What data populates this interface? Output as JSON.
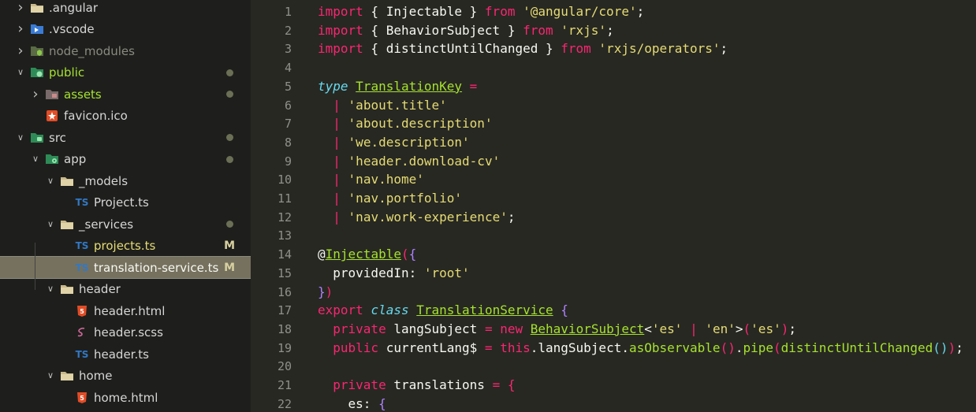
{
  "explorer": {
    "items": [
      {
        "label": ".angular",
        "icon": "folder-icon",
        "depth": 0,
        "chevron": "right",
        "color": "#d6d6d6"
      },
      {
        "label": ".vscode",
        "icon": "vscode-folder-icon",
        "depth": 0,
        "chevron": "right",
        "color": "#d6d6d6"
      },
      {
        "label": "node_modules",
        "icon": "node-folder-icon",
        "depth": 0,
        "chevron": "right",
        "color": "#8a8a80"
      },
      {
        "label": "public",
        "icon": "public-folder-icon",
        "depth": 0,
        "chevron": "down",
        "color": "#a6e22e",
        "dot": true
      },
      {
        "label": "assets",
        "icon": "assets-folder-icon",
        "depth": 1,
        "chevron": "right",
        "color": "#a6e22e",
        "dot": true
      },
      {
        "label": "favicon.ico",
        "icon": "favicon-icon",
        "depth": 1,
        "chevron": "none",
        "color": "#d6d6d6"
      },
      {
        "label": "src",
        "icon": "src-folder-icon",
        "depth": 0,
        "chevron": "down",
        "color": "#d6d6d6",
        "dot": true
      },
      {
        "label": "app",
        "icon": "app-folder-icon",
        "depth": 1,
        "chevron": "down",
        "color": "#d6d6d6",
        "dot": true
      },
      {
        "label": "_models",
        "icon": "folder-icon",
        "depth": 2,
        "chevron": "down",
        "color": "#d6d6d6"
      },
      {
        "label": "Project.ts",
        "icon": "typescript-icon",
        "depth": 3,
        "chevron": "none",
        "color": "#d6d6d6"
      },
      {
        "label": "_services",
        "icon": "folder-icon",
        "depth": 2,
        "chevron": "down",
        "color": "#d6d6d6",
        "dot": true
      },
      {
        "label": "projects.ts",
        "icon": "typescript-icon",
        "depth": 3,
        "chevron": "none",
        "color": "#e6db74",
        "badge": "M"
      },
      {
        "label": "translation-service.ts",
        "icon": "typescript-icon",
        "depth": 3,
        "chevron": "none",
        "color": "#f8f8f2",
        "badge": "M",
        "selected": true
      },
      {
        "label": "header",
        "icon": "folder-icon",
        "depth": 2,
        "chevron": "down",
        "color": "#d6d6d6"
      },
      {
        "label": "header.html",
        "icon": "html-icon",
        "depth": 3,
        "chevron": "none",
        "color": "#d6d6d6"
      },
      {
        "label": "header.scss",
        "icon": "sass-icon",
        "depth": 3,
        "chevron": "none",
        "color": "#d6d6d6"
      },
      {
        "label": "header.ts",
        "icon": "typescript-icon",
        "depth": 3,
        "chevron": "none",
        "color": "#d6d6d6"
      },
      {
        "label": "home",
        "icon": "folder-icon",
        "depth": 2,
        "chevron": "down",
        "color": "#d6d6d6"
      },
      {
        "label": "home.html",
        "icon": "html-icon",
        "depth": 3,
        "chevron": "none",
        "color": "#d6d6d6"
      }
    ]
  },
  "editor": {
    "lines": [
      [
        [
          "k",
          "import"
        ],
        [
          "p",
          " { Injectable } "
        ],
        [
          "k",
          "from"
        ],
        [
          "p",
          " "
        ],
        [
          "s",
          "'@angular/core'"
        ],
        [
          "p",
          ";"
        ]
      ],
      [
        [
          "k",
          "import"
        ],
        [
          "p",
          " { BehaviorSubject } "
        ],
        [
          "k",
          "from"
        ],
        [
          "p",
          " "
        ],
        [
          "s",
          "'rxjs'"
        ],
        [
          "p",
          ";"
        ]
      ],
      [
        [
          "k",
          "import"
        ],
        [
          "p",
          " { distinctUntilChanged } "
        ],
        [
          "k",
          "from"
        ],
        [
          "p",
          " "
        ],
        [
          "s",
          "'rxjs/operators'"
        ],
        [
          "p",
          ";"
        ]
      ],
      [],
      [
        [
          "t",
          "type"
        ],
        [
          "p",
          " "
        ],
        [
          "c",
          "TranslationKey"
        ],
        [
          "p",
          " "
        ],
        [
          "k",
          "="
        ]
      ],
      [
        [
          "p",
          "  "
        ],
        [
          "k",
          "|"
        ],
        [
          "p",
          " "
        ],
        [
          "s",
          "'about.title'"
        ]
      ],
      [
        [
          "p",
          "  "
        ],
        [
          "k",
          "|"
        ],
        [
          "p",
          " "
        ],
        [
          "s",
          "'about.description'"
        ]
      ],
      [
        [
          "p",
          "  "
        ],
        [
          "k",
          "|"
        ],
        [
          "p",
          " "
        ],
        [
          "s",
          "'we.description'"
        ]
      ],
      [
        [
          "p",
          "  "
        ],
        [
          "k",
          "|"
        ],
        [
          "p",
          " "
        ],
        [
          "s",
          "'header.download-cv'"
        ]
      ],
      [
        [
          "p",
          "  "
        ],
        [
          "k",
          "|"
        ],
        [
          "p",
          " "
        ],
        [
          "s",
          "'nav.home'"
        ]
      ],
      [
        [
          "p",
          "  "
        ],
        [
          "k",
          "|"
        ],
        [
          "p",
          " "
        ],
        [
          "s",
          "'nav.portfolio'"
        ]
      ],
      [
        [
          "p",
          "  "
        ],
        [
          "k",
          "|"
        ],
        [
          "p",
          " "
        ],
        [
          "s",
          "'nav.work-experience'"
        ],
        [
          "p",
          ";"
        ]
      ],
      [],
      [
        [
          "p",
          "@"
        ],
        [
          "c",
          "Injectable"
        ],
        [
          "b1",
          "("
        ],
        [
          "b2",
          "{"
        ]
      ],
      [
        [
          "p",
          "  providedIn: "
        ],
        [
          "s",
          "'root'"
        ]
      ],
      [
        [
          "b2",
          "}"
        ],
        [
          "b1",
          ")"
        ]
      ],
      [
        [
          "k",
          "export"
        ],
        [
          "p",
          " "
        ],
        [
          "t",
          "class"
        ],
        [
          "p",
          " "
        ],
        [
          "c",
          "TranslationService"
        ],
        [
          "p",
          " "
        ],
        [
          "b2",
          "{"
        ]
      ],
      [
        [
          "p",
          "  "
        ],
        [
          "k",
          "private"
        ],
        [
          "p",
          " langSubject "
        ],
        [
          "k",
          "="
        ],
        [
          "p",
          " "
        ],
        [
          "k",
          "new"
        ],
        [
          "p",
          " "
        ],
        [
          "c",
          "BehaviorSubject"
        ],
        [
          "p",
          "<"
        ],
        [
          "s",
          "'es'"
        ],
        [
          "p",
          " "
        ],
        [
          "k",
          "|"
        ],
        [
          "p",
          " "
        ],
        [
          "s",
          "'en'"
        ],
        [
          "p",
          ">"
        ],
        [
          "b1",
          "("
        ],
        [
          "s",
          "'es'"
        ],
        [
          "b1",
          ")"
        ],
        [
          "p",
          ";"
        ]
      ],
      [
        [
          "p",
          "  "
        ],
        [
          "k",
          "public"
        ],
        [
          "p",
          " currentLang$ "
        ],
        [
          "k",
          "="
        ],
        [
          "p",
          " "
        ],
        [
          "k",
          "this"
        ],
        [
          "p",
          ".langSubject."
        ],
        [
          "f",
          "asObservable"
        ],
        [
          "b1",
          "()"
        ],
        [
          "p",
          "."
        ],
        [
          "f",
          "pipe"
        ],
        [
          "b1",
          "("
        ],
        [
          "f",
          "distinctUntilChanged"
        ],
        [
          "b3",
          "()"
        ],
        [
          "b1",
          ")"
        ],
        [
          "p",
          ";"
        ]
      ],
      [],
      [
        [
          "p",
          "  "
        ],
        [
          "k",
          "private"
        ],
        [
          "p",
          " translations "
        ],
        [
          "k",
          "="
        ],
        [
          "p",
          " "
        ],
        [
          "b1",
          "{"
        ]
      ],
      [
        [
          "p",
          "    es: "
        ],
        [
          "b2",
          "{"
        ]
      ]
    ],
    "line_numbers": [
      "1",
      "2",
      "3",
      "4",
      "5",
      "6",
      "7",
      "8",
      "9",
      "10",
      "11",
      "12",
      "13",
      "14",
      "15",
      "16",
      "17",
      "18",
      "19",
      "20",
      "21",
      "22"
    ]
  }
}
